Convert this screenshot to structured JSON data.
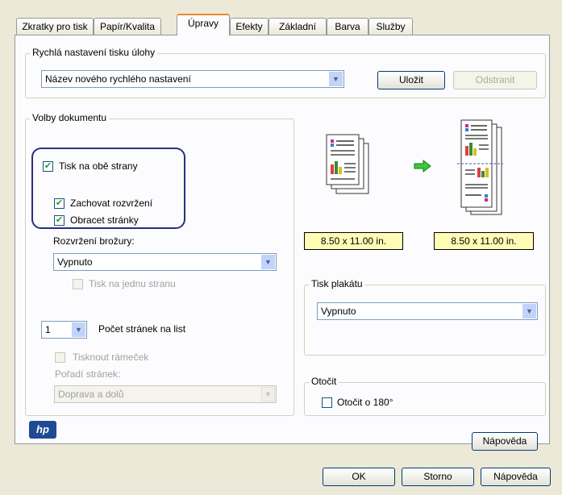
{
  "tabs": [
    {
      "label": "Zkratky pro tisk"
    },
    {
      "label": "Papír/Kvalita"
    },
    {
      "label": "Úpravy"
    },
    {
      "label": "Efekty"
    },
    {
      "label": "Základní"
    },
    {
      "label": "Barva"
    },
    {
      "label": "Služby"
    }
  ],
  "quick_settings": {
    "legend": "Rychlá nastavení tisku úlohy",
    "select_value": "Název nového rychlého nastavení",
    "save_label": "Uložit",
    "delete_label": "Odstranit"
  },
  "document_options": {
    "legend": "Volby dokumentu",
    "duplex_label": "Tisk na obě strany",
    "keep_layout_label": "Zachovat rozvržení",
    "flip_pages_label": "Obracet stránky",
    "booklet_label": "Rozvržení brožury:",
    "booklet_value": "Vypnuto",
    "one_side_label": "Tisk na jednu stranu",
    "pages_per_sheet_value": "1",
    "pages_per_sheet_label": "Počet stránek na list",
    "print_border_label": "Tisknout rámeček",
    "page_order_label": "Pořadí stránek:",
    "page_order_value": "Doprava a dolů"
  },
  "preview": {
    "size_left": "8.50 x 11.00 in.",
    "size_right": "8.50 x 11.00 in."
  },
  "poster": {
    "legend": "Tisk plakátu",
    "value": "Vypnuto"
  },
  "rotate": {
    "legend": "Otočit",
    "label": "Otočit o 180°"
  },
  "panel_help_label": "Nápověda",
  "footer": {
    "ok_label": "OK",
    "cancel_label": "Storno",
    "help_label": "Nápověda"
  },
  "logo_text": "hp"
}
